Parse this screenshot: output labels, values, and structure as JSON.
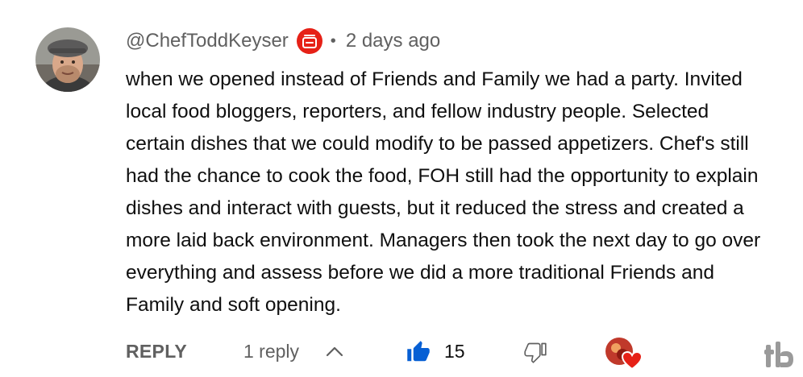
{
  "comment": {
    "author": "@ChefToddKeyser",
    "separator": "•",
    "timestamp": "2 days ago",
    "text": "when we opened instead of Friends and Family we had a party. Invited\nlocal food bloggers, reporters, and fellow industry people. Selected\ncertain dishes that we could modify to be passed appetizers. Chef's still\nhad the chance to cook the food, FOH still had the opportunity to explain\ndishes and interact with guests, but it reduced the stress and created a\nmore laid back environment. Managers then took the next day to go over\neverything and assess before we did a more traditional Friends and\nFamily and soft opening."
  },
  "actions": {
    "reply_label": "REPLY",
    "replies_label": "1 reply",
    "like_count": "15"
  },
  "icons": {
    "avatar": "avatar",
    "creator_badge": "creator-badge-icon",
    "chevron": "chevron-up-icon",
    "like": "thumbs-up-icon",
    "dislike": "thumbs-down-icon",
    "creator_heart": "creator-heart-icon",
    "extension_logo": "tubebuddy-logo-icon"
  },
  "colors": {
    "badge_red": "#e62117",
    "like_blue": "#065fd4",
    "secondary_text": "#606060",
    "primary_text": "#0f0f0f"
  }
}
